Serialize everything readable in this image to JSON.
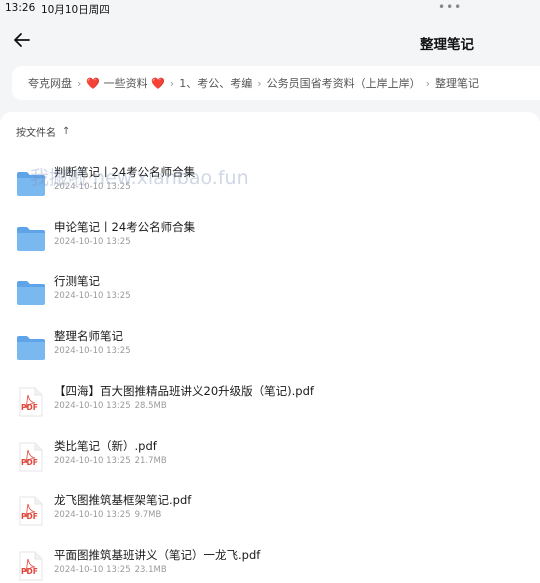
{
  "status": {
    "time": "13:26",
    "date": "10月10日周四",
    "dots": "•••"
  },
  "header": {
    "title": "整理笔记"
  },
  "breadcrumb": [
    {
      "label": "夸克网盘"
    },
    {
      "label": "❤️ 一些资料 ❤️"
    },
    {
      "label": "1、考公、考编"
    },
    {
      "label": "公务员国省考资料（上岸上岸）"
    },
    {
      "label": "整理笔记"
    }
  ],
  "breadcrumb_separator": "›",
  "sort": {
    "label": "按文件名",
    "arrow": "↑"
  },
  "watermark": "我搬啦·new.xianbao.fun",
  "files": [
    {
      "type": "folder",
      "name": "判断笔记丨24考公名师合集",
      "date": "2024-10-10 13:25",
      "size": ""
    },
    {
      "type": "folder",
      "name": "申论笔记丨24考公名师合集",
      "date": "2024-10-10 13:25",
      "size": ""
    },
    {
      "type": "folder",
      "name": "行测笔记",
      "date": "2024-10-10 13:25",
      "size": ""
    },
    {
      "type": "folder",
      "name": "整理名师笔记",
      "date": "2024-10-10 13:25",
      "size": ""
    },
    {
      "type": "pdf",
      "name": "【四海】百大图推精品班讲义20升级版（笔记).pdf",
      "date": "2024-10-10 13:25",
      "size": "28.5MB"
    },
    {
      "type": "pdf",
      "name": "类比笔记（新）.pdf",
      "date": "2024-10-10 13:25",
      "size": "21.7MB"
    },
    {
      "type": "pdf",
      "name": "龙飞图推筑基框架笔记.pdf",
      "date": "2024-10-10 13:25",
      "size": "9.7MB"
    },
    {
      "type": "pdf",
      "name": "平面图推筑基班讲义（笔记）一龙飞.pdf",
      "date": "2024-10-10 13:25",
      "size": "23.1MB"
    }
  ],
  "icons": {
    "folder": "folder-icon",
    "pdf": "pdf-file-icon",
    "pdf_label": "PDF"
  },
  "colors": {
    "folder": "#7ab8f0",
    "folder_tab": "#5fa4e8",
    "pdf_red": "#e2463b"
  }
}
